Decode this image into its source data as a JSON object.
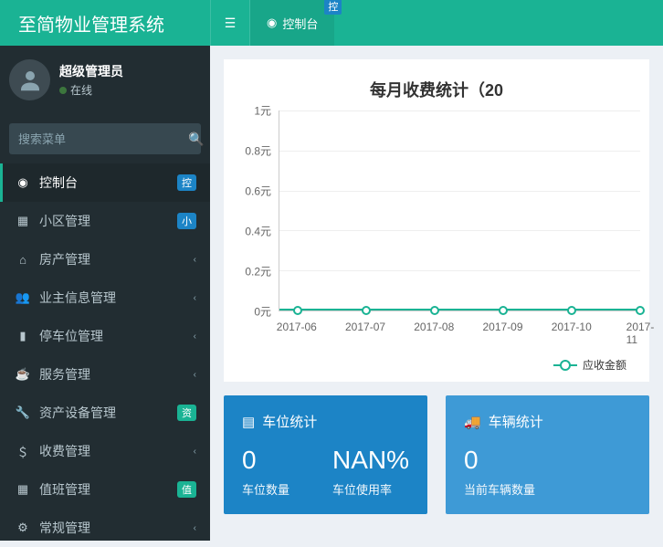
{
  "header": {
    "brand": "至简物业管理系统",
    "tab_label": "控制台",
    "tab_badge": "控"
  },
  "user": {
    "name": "超级管理员",
    "status": "在线"
  },
  "search": {
    "placeholder": "搜索菜单"
  },
  "menu": [
    {
      "icon": "dashboard",
      "label": "控制台",
      "badge": "控",
      "badge_color": "blue",
      "active": true
    },
    {
      "icon": "list",
      "label": "小区管理",
      "badge": "小",
      "badge_color": "blue"
    },
    {
      "icon": "home",
      "label": "房产管理",
      "chevron": true
    },
    {
      "icon": "users",
      "label": "业主信息管理",
      "chevron": true
    },
    {
      "icon": "parking",
      "label": "停车位管理",
      "chevron": true
    },
    {
      "icon": "coffee",
      "label": "服务管理",
      "chevron": true
    },
    {
      "icon": "wrench",
      "label": "资产设备管理",
      "badge": "资",
      "badge_color": "green"
    },
    {
      "icon": "money",
      "label": "收费管理",
      "chevron": true
    },
    {
      "icon": "calendar",
      "label": "值班管理",
      "badge": "值",
      "badge_color": "green"
    },
    {
      "icon": "cogs",
      "label": "常规管理",
      "chevron": true
    }
  ],
  "chart_data": {
    "type": "line",
    "title": "每月收费统计（20",
    "ylabel": "",
    "y_ticks": [
      "1元",
      "0.8元",
      "0.6元",
      "0.4元",
      "0.2元",
      "0元"
    ],
    "ylim": [
      0,
      1
    ],
    "categories": [
      "2017-06",
      "2017-07",
      "2017-08",
      "2017-09",
      "2017-10",
      "2017-11"
    ],
    "series": [
      {
        "name": "应收金额",
        "values": [
          0,
          0,
          0,
          0,
          0,
          0
        ],
        "color": "#1ab394"
      }
    ]
  },
  "stats": {
    "parking": {
      "title": "车位统计",
      "cols": [
        {
          "value": "0",
          "label": "车位数量"
        },
        {
          "value": "NAN%",
          "label": "车位使用率"
        }
      ]
    },
    "vehicle": {
      "title": "车辆统计",
      "cols": [
        {
          "value": "0",
          "label": "当前车辆数量"
        }
      ]
    }
  }
}
